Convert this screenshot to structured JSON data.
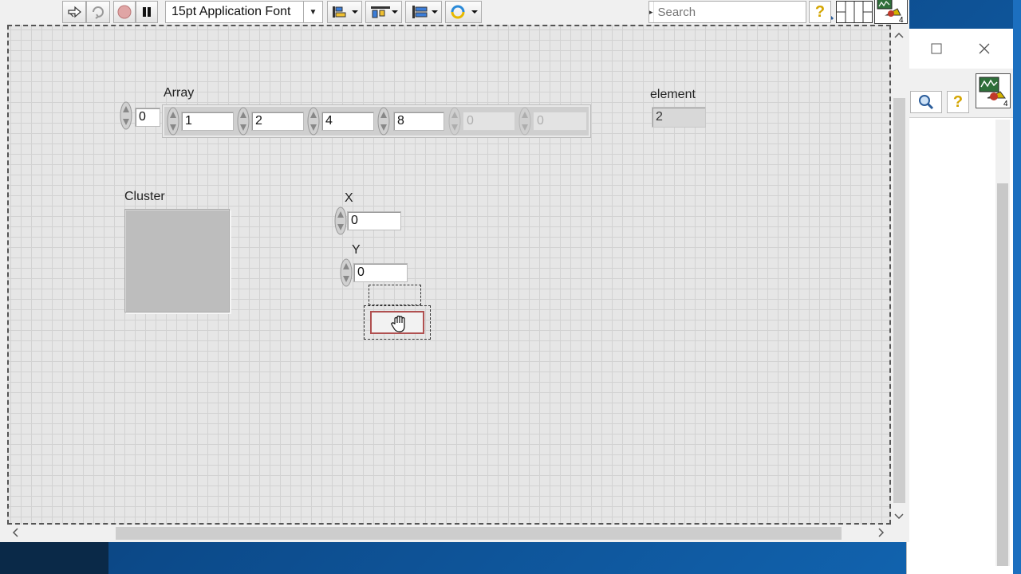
{
  "toolbar": {
    "font_select": "15pt Application Font",
    "search_placeholder": "Search",
    "help": "?",
    "vi_icon_number": "4"
  },
  "panel": {
    "array": {
      "label": "Array",
      "index": "0",
      "elements": [
        "1",
        "2",
        "4",
        "8",
        "0",
        "0"
      ]
    },
    "element": {
      "label": "element",
      "value": "2"
    },
    "cluster": {
      "label": "Cluster"
    },
    "x": {
      "label": "X",
      "value": "0"
    },
    "y": {
      "label": "Y",
      "value": "0"
    }
  },
  "background_window": {
    "help": "?",
    "vi_icon_number": "4"
  }
}
